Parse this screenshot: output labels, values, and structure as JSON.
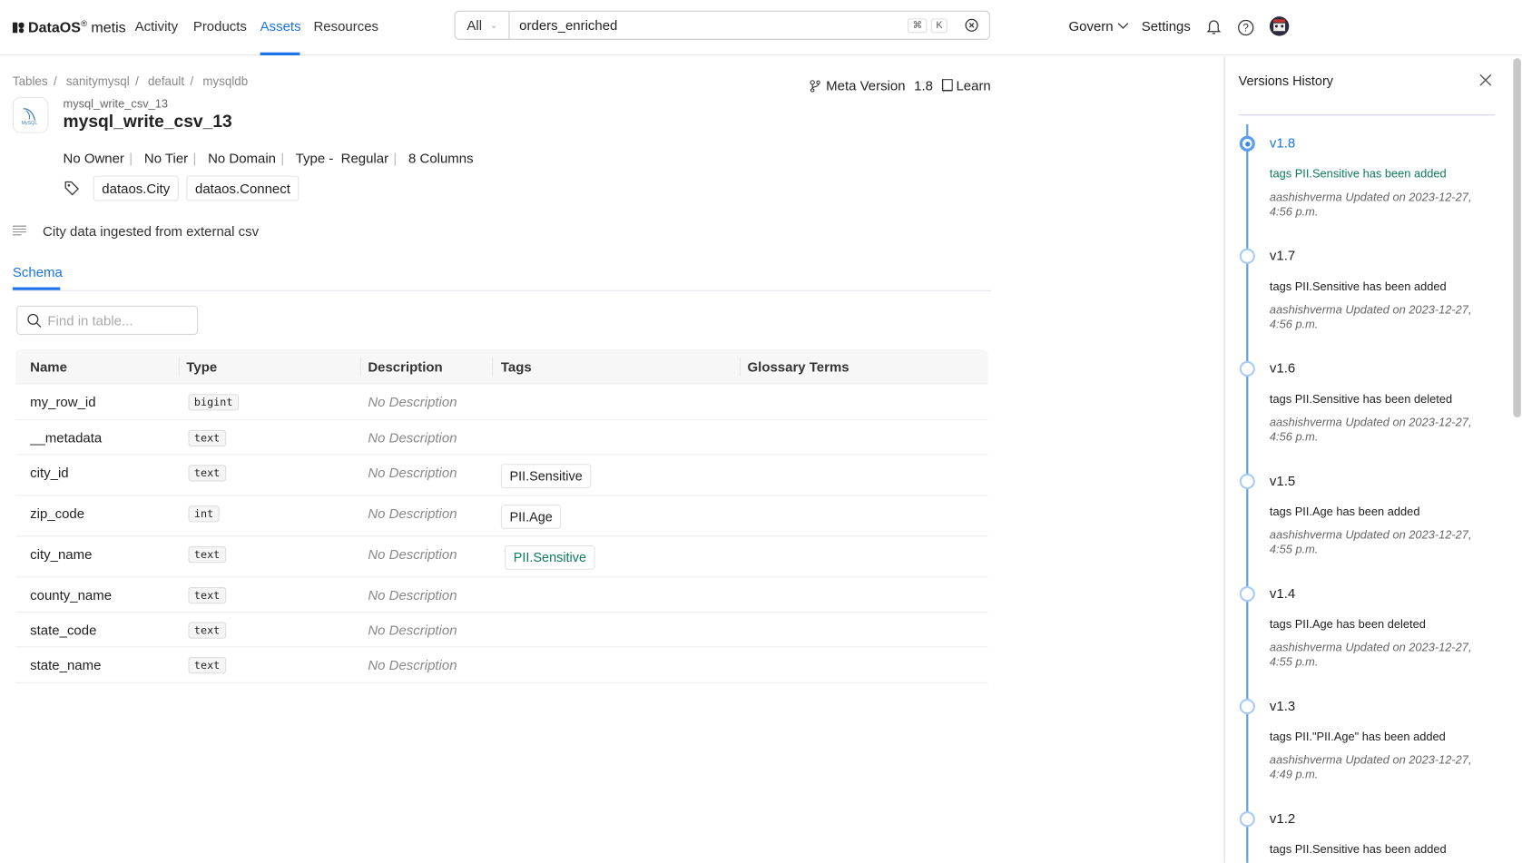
{
  "brand": {
    "name": "DataOS",
    "reg": "®",
    "product": "metis"
  },
  "nav": [
    {
      "label": "Activity"
    },
    {
      "label": "Products"
    },
    {
      "label": "Assets",
      "active": true
    },
    {
      "label": "Resources"
    }
  ],
  "search": {
    "filter": "All",
    "value": "orders_enriched",
    "shortcut_cmd": "⌘",
    "shortcut_key": "K"
  },
  "header_right": {
    "govern": "Govern",
    "settings": "Settings"
  },
  "breadcrumb": [
    "Tables",
    "sanitymysql",
    "default",
    "mysqldb"
  ],
  "asset": {
    "fqn": "mysql_write_csv_13",
    "name": "mysql_write_csv_13",
    "owner": "No Owner",
    "tier": "No Tier",
    "domain": "No Domain",
    "type_label": "Type -",
    "type": "Regular",
    "columns": "8 Columns",
    "tags": [
      "dataos.City",
      "dataos.Connect"
    ],
    "description": "City data ingested from external csv"
  },
  "meta_version": {
    "label": "Meta Version",
    "value": "1.8",
    "learn": "Learn"
  },
  "tabs": [
    {
      "label": "Schema",
      "active": true
    }
  ],
  "table": {
    "search_placeholder": "Find in table...",
    "columns": [
      "Name",
      "Type",
      "Description",
      "Tags",
      "Glossary Terms"
    ],
    "rows": [
      {
        "name": "my_row_id",
        "type": "bigint",
        "description": "No Description",
        "tag": ""
      },
      {
        "name": "__metadata",
        "type": "text",
        "description": "No Description",
        "tag": ""
      },
      {
        "name": "city_id",
        "type": "text",
        "description": "No Description",
        "tag": "PII.Sensitive"
      },
      {
        "name": "zip_code",
        "type": "int",
        "description": "No Description",
        "tag": "PII.Age"
      },
      {
        "name": "city_name",
        "type": "text",
        "description": "No Description",
        "tag": "PII.Sensitive",
        "tag_highlight": true
      },
      {
        "name": "county_name",
        "type": "text",
        "description": "No Description",
        "tag": ""
      },
      {
        "name": "state_code",
        "type": "text",
        "description": "No Description",
        "tag": ""
      },
      {
        "name": "state_name",
        "type": "text",
        "description": "No Description",
        "tag": ""
      }
    ]
  },
  "versions_panel": {
    "title": "Versions History",
    "versions": [
      {
        "version": "v1.8",
        "message": "tags PII.Sensitive has been added",
        "by": "aashishverma Updated on 2023-12-27, 4:56 p.m.",
        "current": true
      },
      {
        "version": "v1.7",
        "message": "tags PII.Sensitive has been added",
        "by": "aashishverma Updated on 2023-12-27, 4:56 p.m."
      },
      {
        "version": "v1.6",
        "message": "tags PII.Sensitive has been deleted",
        "by": "aashishverma Updated on 2023-12-27, 4:56 p.m."
      },
      {
        "version": "v1.5",
        "message": "tags PII.Age has been added",
        "by": "aashishverma Updated on 2023-12-27, 4:55 p.m."
      },
      {
        "version": "v1.4",
        "message": "tags PII.Age has been deleted",
        "by": "aashishverma Updated on 2023-12-27, 4:55 p.m."
      },
      {
        "version": "v1.3",
        "message": "tags PII.\"PII.Age\" has been added",
        "by": "aashishverma Updated on 2023-12-27, 4:49 p.m."
      },
      {
        "version": "v1.2",
        "message": "tags PII.Sensitive has been added",
        "by": ""
      }
    ]
  },
  "colors": {
    "accent": "#1a73e8",
    "highlight": "#0f7b5f",
    "timeline": "#5b9bf0"
  }
}
